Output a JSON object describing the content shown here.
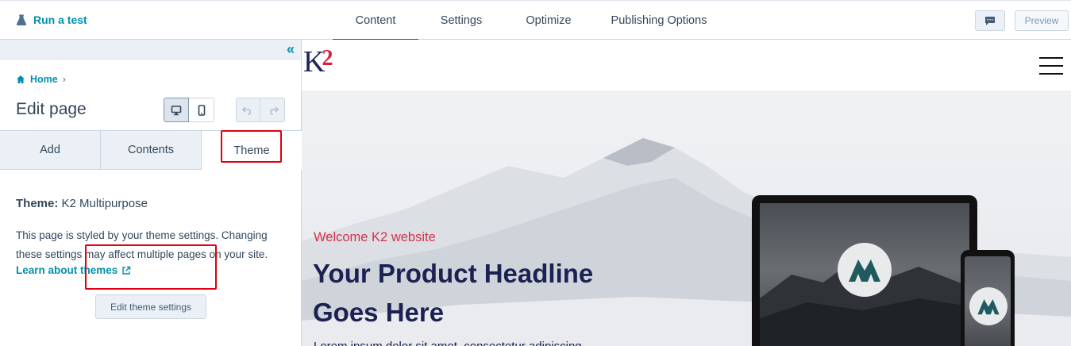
{
  "topbar": {
    "run_test": "Run a test",
    "tabs": [
      {
        "label": "Content",
        "active": true
      },
      {
        "label": "Settings",
        "active": false
      },
      {
        "label": "Optimize",
        "active": false
      },
      {
        "label": "Publishing Options",
        "active": false
      }
    ],
    "comment_icon": "comment-icon",
    "preview": "Preview"
  },
  "panel": {
    "collapse_icon": "double-chevron-left-icon",
    "breadcrumb": {
      "home": "Home",
      "separator": "›"
    },
    "title": "Edit page",
    "device_buttons": [
      "desktop-icon",
      "mobile-icon"
    ],
    "undo_icons": [
      "undo-icon",
      "redo-icon"
    ],
    "tabs": [
      {
        "label": "Add",
        "active": false
      },
      {
        "label": "Contents",
        "active": false
      },
      {
        "label": "Theme",
        "active": true
      }
    ],
    "theme_label": "Theme:",
    "theme_name": "K2 Multipurpose",
    "description": "This page is styled by your theme settings. Changing these settings may affect multiple pages on your site.",
    "learn_link": "Learn about themes",
    "edit_button": "Edit theme settings"
  },
  "preview": {
    "logo_k": "K",
    "logo_2": "2",
    "welcome": "Welcome K2 website",
    "headline": "Your Product Headline Goes Here",
    "body_partial": "Lorem ipsum dolor sit amet, consectetur adipiscing"
  },
  "colors": {
    "accent": "#0091ae",
    "text": "#33475b",
    "highlight": "#e0000f",
    "welcome": "#d6304a",
    "headline": "#1c2154"
  }
}
